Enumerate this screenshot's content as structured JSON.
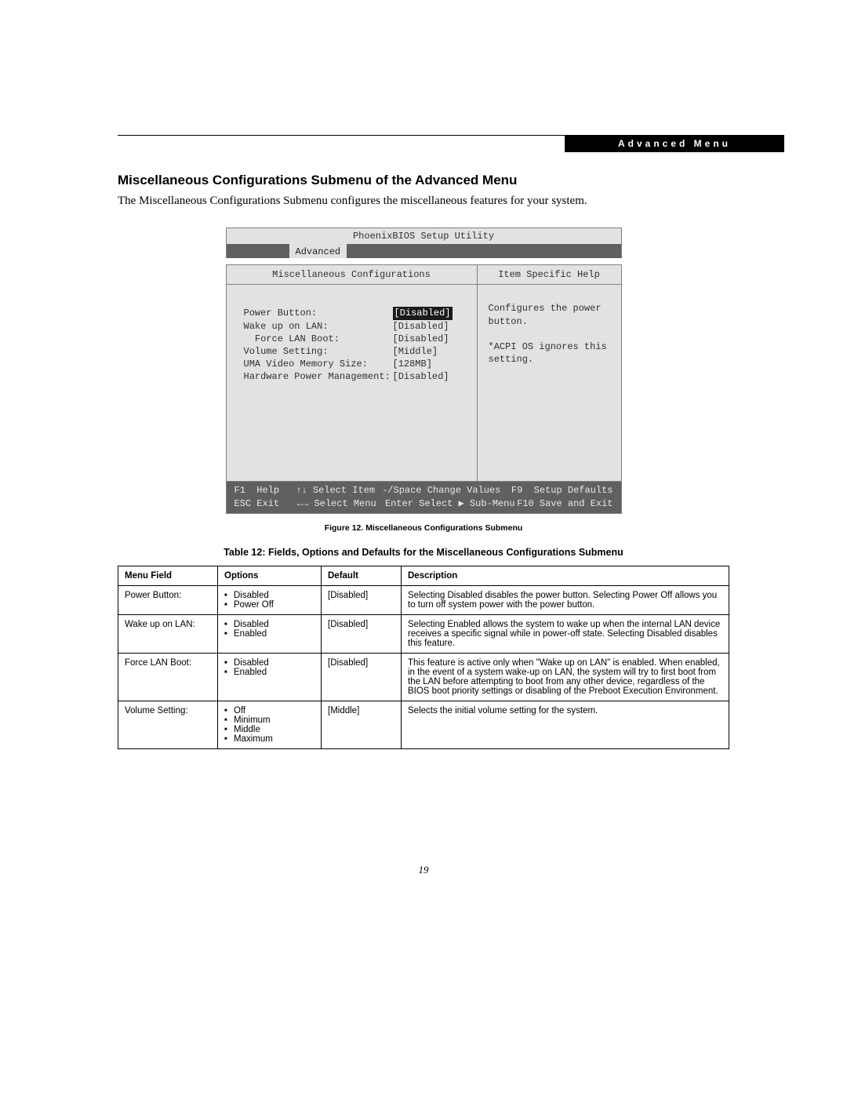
{
  "header_tab": "Advanced Menu",
  "heading": "Miscellaneous Configurations Submenu of the Advanced Menu",
  "intro": "The Miscellaneous Configurations Submenu configures the miscellaneous features for your system.",
  "bios": {
    "title": "PhoenixBIOS Setup Utility",
    "active_tab": "Advanced",
    "left_header": "Miscellaneous Configurations",
    "right_header": "Item Specific Help",
    "options": [
      {
        "label": "Power Button:",
        "value": "[Disabled]",
        "selected": true
      },
      {
        "label": "Wake up on LAN:",
        "value": "[Disabled]",
        "selected": false
      },
      {
        "label": "  Force LAN Boot:",
        "value": "[Disabled]",
        "selected": false
      },
      {
        "label": "Volume Setting:",
        "value": "[Middle]",
        "selected": false
      },
      {
        "label": "UMA Video Memory Size:",
        "value": "[128MB]",
        "selected": false
      },
      {
        "label": "Hardware Power Management:",
        "value": "[Disabled]",
        "selected": false
      }
    ],
    "help_lines": [
      "Configures the power",
      "button.",
      "",
      "*ACPI OS ignores this",
      "setting."
    ],
    "footer": {
      "r1": {
        "c1": "F1  Help",
        "c2": "↑↓ Select Item",
        "c3": "-/Space Change Values",
        "c4": "F9  Setup Defaults"
      },
      "r2": {
        "c1": "ESC Exit",
        "c2": "←→ Select Menu",
        "c3": "Enter Select ▶ Sub-Menu",
        "c4": "F10 Save and Exit"
      }
    }
  },
  "figure_caption": "Figure 12.  Miscellaneous Configurations Submenu",
  "table_caption": "Table 12: Fields, Options and Defaults for the Miscellaneous Configurations Submenu",
  "table": {
    "headers": {
      "field": "Menu Field",
      "options": "Options",
      "def": "Default",
      "desc": "Description"
    },
    "rows": [
      {
        "field": "Power Button:",
        "indent": false,
        "options": [
          "Disabled",
          "Power Off"
        ],
        "def": "[Disabled]",
        "desc": "Selecting Disabled disables the power button. Selecting Power Off allows you to turn off system power with the power button."
      },
      {
        "field": "Wake up on LAN:",
        "indent": false,
        "options": [
          "Disabled",
          "Enabled"
        ],
        "def": "[Disabled]",
        "desc": "Selecting Enabled allows the system to wake up when the internal LAN device receives a specific signal while in power-off state. Selecting Disabled disables this feature."
      },
      {
        "field": "Force LAN Boot:",
        "indent": true,
        "options": [
          "Disabled",
          "Enabled"
        ],
        "def": "[Disabled]",
        "desc": "This feature is active only when \"Wake up on LAN\" is enabled. When enabled, in the event of a system wake-up on LAN, the system will try to first boot from the LAN before attempting to boot from any other device, regardless of the BIOS boot priority settings or disabling of the Preboot Execution Environment."
      },
      {
        "field": "Volume Setting:",
        "indent": false,
        "options": [
          "Off",
          "Minimum",
          "Middle",
          "Maximum"
        ],
        "def": "[Middle]",
        "desc": "Selects the initial volume setting for the system."
      }
    ]
  },
  "page_number": "19"
}
